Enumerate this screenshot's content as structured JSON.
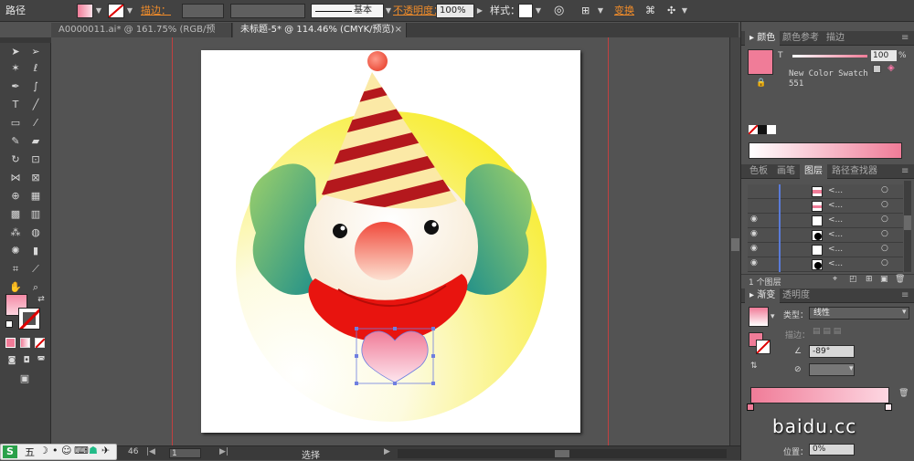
{
  "control_bar": {
    "object_label": "路径",
    "stroke_label": "描边：",
    "stroke_style": "基本",
    "opacity_label": "不透明度：",
    "opacity_value": "100%",
    "style_label": "样式：",
    "transform_label": "变换"
  },
  "tabs": [
    {
      "label": "A0000011.ai* @ 161.75% (RGB/预览)"
    },
    {
      "label": "未标题-5* @ 114.46% (CMYK/预览)"
    }
  ],
  "status": {
    "zoom": "46",
    "page": "1",
    "tool": "选择"
  },
  "color_panel": {
    "tabs": [
      "颜色",
      "颜色参考",
      "描边"
    ],
    "tint_label": "T",
    "tint_value": "100",
    "tint_unit": "%",
    "swatch_name": "New Color Swatch",
    "swatch_number": "551"
  },
  "layers_panel": {
    "tabs": [
      "色板",
      "画笔",
      "图层",
      "路径查找器"
    ],
    "rows": [
      {
        "label": "<..."
      },
      {
        "label": "<..."
      },
      {
        "label": "<..."
      },
      {
        "label": "<..."
      },
      {
        "label": "<..."
      },
      {
        "label": "<..."
      }
    ],
    "count": "1 个图层"
  },
  "gradient_panel": {
    "tabs": [
      "渐变",
      "透明度"
    ],
    "type_label": "类型：",
    "type_value": "线性",
    "stroke_label": "描边：",
    "angle_value": "-89°",
    "location_label": "位置：",
    "location_value": "0%"
  },
  "watermark": "baidu.cc",
  "colors": {
    "accent_pink": "#f07c98",
    "ui_dark": "#424242"
  }
}
